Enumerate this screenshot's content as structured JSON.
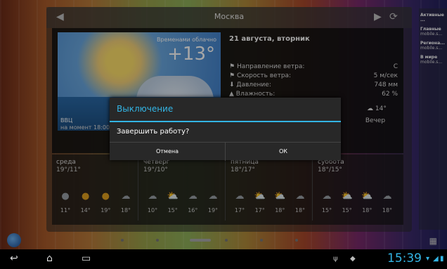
{
  "widget": {
    "city": "Москва",
    "current": {
      "condition": "Временами облачно",
      "temperature": "+13°",
      "place": "ВВЦ",
      "updated": "на момент 18:00"
    },
    "details": {
      "date": "21 августа, вторник",
      "rows": [
        {
          "label": "Направление ветра:",
          "value": "С"
        },
        {
          "label": "Скорость ветра:",
          "value": "5 м/сек"
        },
        {
          "label": "Давление:",
          "value": "748 мм"
        },
        {
          "label": "Влажность:",
          "value": "62 %"
        }
      ],
      "evening_temp": "14°",
      "evening_label": "Вечер"
    },
    "days": [
      {
        "name": "среда",
        "range": "19°/11°",
        "temps": [
          "11°",
          "14°",
          "19°",
          "18°"
        ]
      },
      {
        "name": "четверг",
        "range": "19°/10°",
        "temps": [
          "10°",
          "15°",
          "16°",
          "19°"
        ]
      },
      {
        "name": "пятница",
        "range": "18°/17°",
        "temps": [
          "17°",
          "17°",
          "18°",
          "18°"
        ]
      },
      {
        "name": "суббота",
        "range": "18°/15°",
        "temps": [
          "15°",
          "15°",
          "18°",
          "18°"
        ]
      }
    ]
  },
  "side_panel": {
    "title": "Активные ...",
    "items": [
      {
        "head": "Главные",
        "sub": "mobile.s..."
      },
      {
        "head": "Региона...",
        "sub": "mobile.s..."
      },
      {
        "head": "В мире",
        "sub": "mobile.s..."
      }
    ]
  },
  "dialog": {
    "title": "Выключение",
    "message": "Завершить работу?",
    "cancel": "Отмена",
    "ok": "ОК"
  },
  "status": {
    "time": "15:39"
  }
}
